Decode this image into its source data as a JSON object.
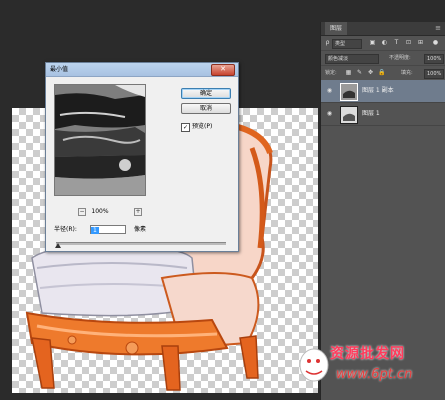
{
  "layers_panel": {
    "tab_label": "图层",
    "menu_icon": "panel-menu-icon",
    "filter": {
      "kind_label": "类型"
    },
    "blend_mode": "颜色减淡",
    "opacity_label": "不透明度:",
    "opacity_value": "100%",
    "lock_label": "锁定:",
    "fill_label": "填充:",
    "fill_value": "100%",
    "layers": [
      {
        "name": "图层 1 副本",
        "selected": true
      },
      {
        "name": "图层 1",
        "selected": false
      }
    ]
  },
  "dialog": {
    "title": "最小值",
    "ok_label": "确定",
    "cancel_label": "取消",
    "preview_label": "预览(P)",
    "preview_checked": true,
    "zoom_out": "−",
    "zoom_in": "+",
    "zoom_value": "100%",
    "radius_label": "半径(R):",
    "radius_value": "1",
    "radius_unit": "像素"
  },
  "watermark": {
    "site_text": "资源批发网",
    "url_text": "www.6pt.cn"
  }
}
